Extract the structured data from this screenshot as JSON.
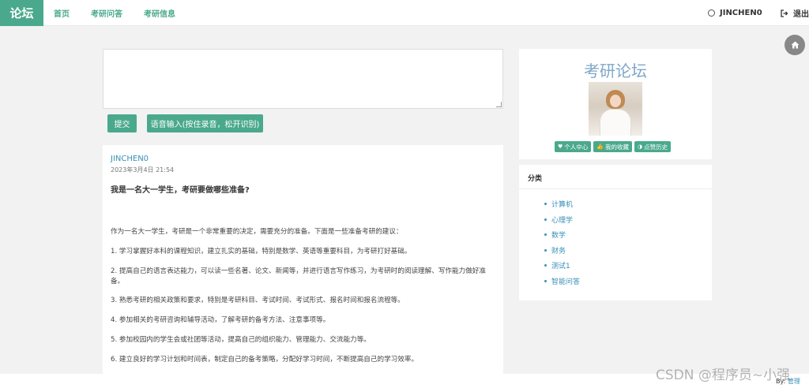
{
  "header": {
    "brand": "论坛",
    "nav": [
      "首页",
      "考研问答",
      "考研信息"
    ],
    "username": "JINCHEN0",
    "logout": "退出"
  },
  "editor": {
    "value": ""
  },
  "buttons": {
    "submit": "提交",
    "voice": "语音输入(按住录音，松开识别)"
  },
  "post": {
    "author": "JINCHEN0",
    "date": "2023年3月4日 21:54",
    "title": "我是一名大一学生，考研要做哪些准备?",
    "paragraphs": [
      "作为一名大一学生，考研是一个非常重要的决定，需要充分的准备。下面是一些准备考研的建议：",
      "1. 学习掌握好本科的课程知识，建立扎实的基础，特别是数学、英语等重要科目，为考研打好基础。",
      "2. 提高自己的语言表达能力，可以读一些名著、论文、新闻等，并进行语言写作练习，为考研时的阅读理解、写作能力做好准备。",
      "3. 熟悉考研的相关政策和要求，特别是考研科目、考试时间、考试形式、报名时间和报名流程等。",
      "4. 参加相关的考研咨询和辅导活动，了解考研的备考方法、注意事项等。",
      "5. 参加校园内的学生会或社团等活动，提高自己的组织能力、管理能力、交流能力等。",
      "6. 建立良好的学习计划和时间表，制定自己的备考策略，分配好学习时间，不断提高自己的学习效率。"
    ]
  },
  "profile": {
    "title": "考研论坛",
    "buttons": [
      "个人中心",
      "我的收藏",
      "点赞历史"
    ]
  },
  "categories": {
    "heading": "分类",
    "items": [
      "计算机",
      "心理学",
      "数学",
      "财务",
      "测试1",
      "智能问答"
    ]
  },
  "footer": {
    "by_label": "By:",
    "by_value": "管理"
  },
  "watermark": "CSDN @程序员~小强"
}
